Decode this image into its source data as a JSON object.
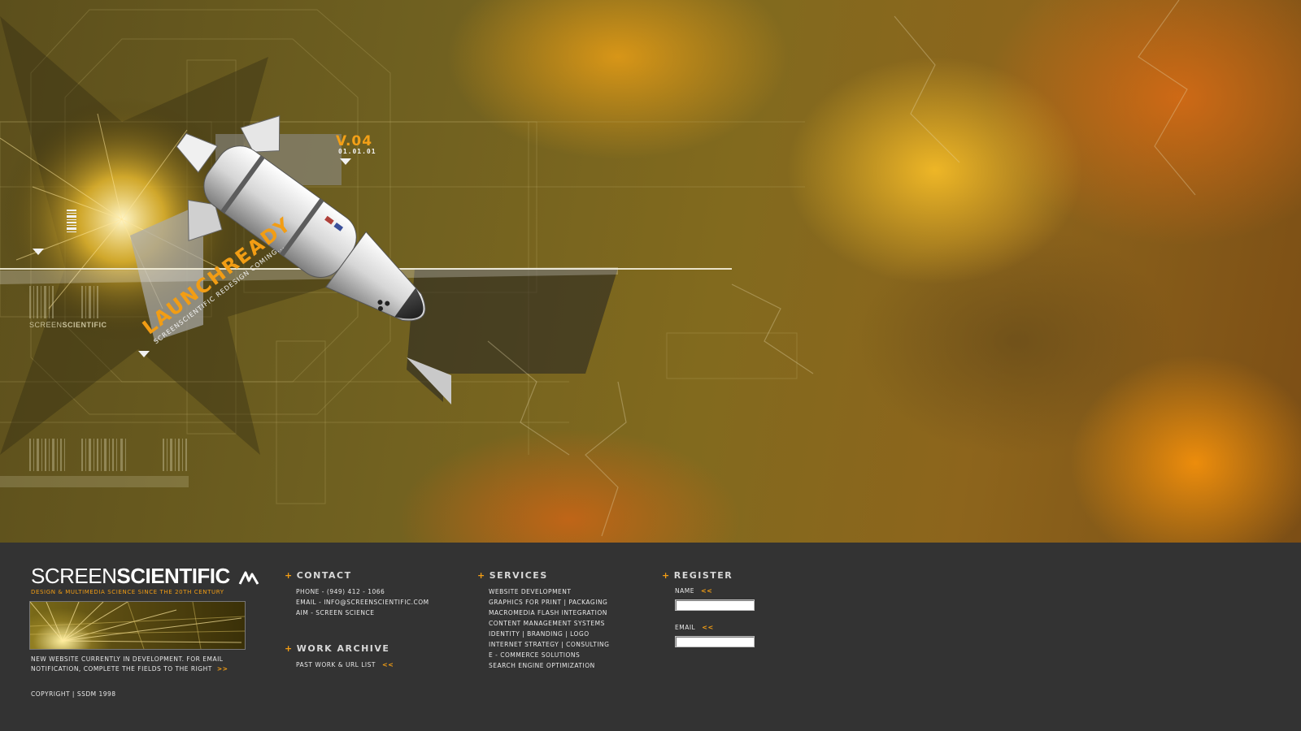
{
  "hero": {
    "version": "V.04",
    "date": "01.01.01",
    "launch_title": "LAUNCHREADY",
    "launch_subtitle": "SCREENSCIENTIFIC  REDESIGN  COMING...",
    "brand_light": "SCREEN",
    "brand_bold": "SCIENTIFIC"
  },
  "brand": {
    "logo_light": "SCREEN",
    "logo_bold": "SCIENTIFIC",
    "tagline": "Design & Multimedia Science Since the 20th Century",
    "notice_line1": "New website currently in development.   For email",
    "notice_line2": "notification,  complete the fields to the right",
    "notice_arrow": ">>",
    "copyright": "Copyright | SSDM 1998"
  },
  "contact": {
    "heading": "Contact",
    "items": [
      "Phone - (949) 412 - 1066",
      "Email - info@screenscientific.com",
      "AIM - Screen Science"
    ]
  },
  "work_archive": {
    "heading": "Work Archive",
    "link": "Past Work & URL List",
    "arrow": "<<"
  },
  "services": {
    "heading": "Services",
    "items": [
      "Website Development",
      "Graphics for Print | Packaging",
      "Macromedia Flash Integration",
      "Content Management Systems",
      "Identity | Branding | Logo",
      "Internet Strategy | Consulting",
      "E - Commerce Solutions",
      "Search Engine Optimization"
    ]
  },
  "register": {
    "heading": "Register",
    "name_label": "Name",
    "email_label": "Email",
    "arrow": "<<",
    "name_value": "",
    "email_value": ""
  },
  "colors": {
    "accent": "#f29d14",
    "footer_bg": "#333333",
    "hero_base": "#6f6020"
  }
}
